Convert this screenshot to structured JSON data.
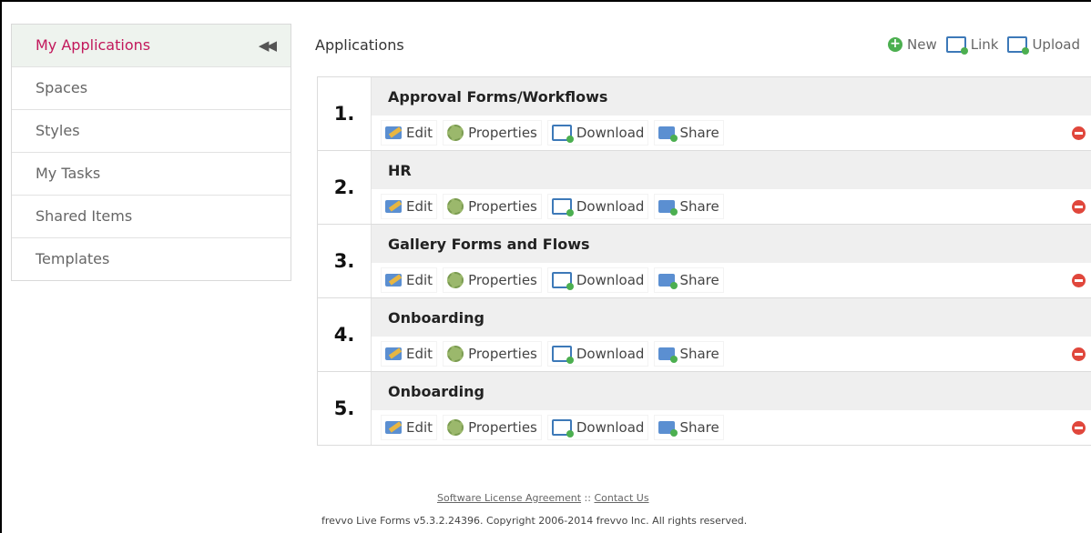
{
  "sidebar": {
    "items": [
      {
        "label": "My Applications",
        "active": true
      },
      {
        "label": "Spaces"
      },
      {
        "label": "Styles"
      },
      {
        "label": "My Tasks"
      },
      {
        "label": "Shared Items"
      },
      {
        "label": "Templates"
      }
    ],
    "collapse_icon": "double-chevron-left-icon"
  },
  "main": {
    "title": "Applications",
    "toolbar": {
      "new_label": "New",
      "link_label": "Link",
      "upload_label": "Upload"
    },
    "actions": {
      "edit": "Edit",
      "properties": "Properties",
      "download": "Download",
      "share": "Share"
    },
    "apps": [
      {
        "num": "1.",
        "name": "Approval Forms/Workflows"
      },
      {
        "num": "2.",
        "name": "HR"
      },
      {
        "num": "3.",
        "name": "Gallery Forms and Flows"
      },
      {
        "num": "4.",
        "name": "Onboarding"
      },
      {
        "num": "5.",
        "name": "Onboarding"
      }
    ]
  },
  "footer": {
    "license_link": "Software License Agreement",
    "separator": "::",
    "contact_link": "Contact Us",
    "copyright": "frevvo Live Forms v5.3.2.24396. Copyright 2006-2014 frevvo Inc. All rights reserved."
  },
  "colors": {
    "active_text": "#c2185b",
    "delete": "#e0473c",
    "add": "#4caf50"
  }
}
